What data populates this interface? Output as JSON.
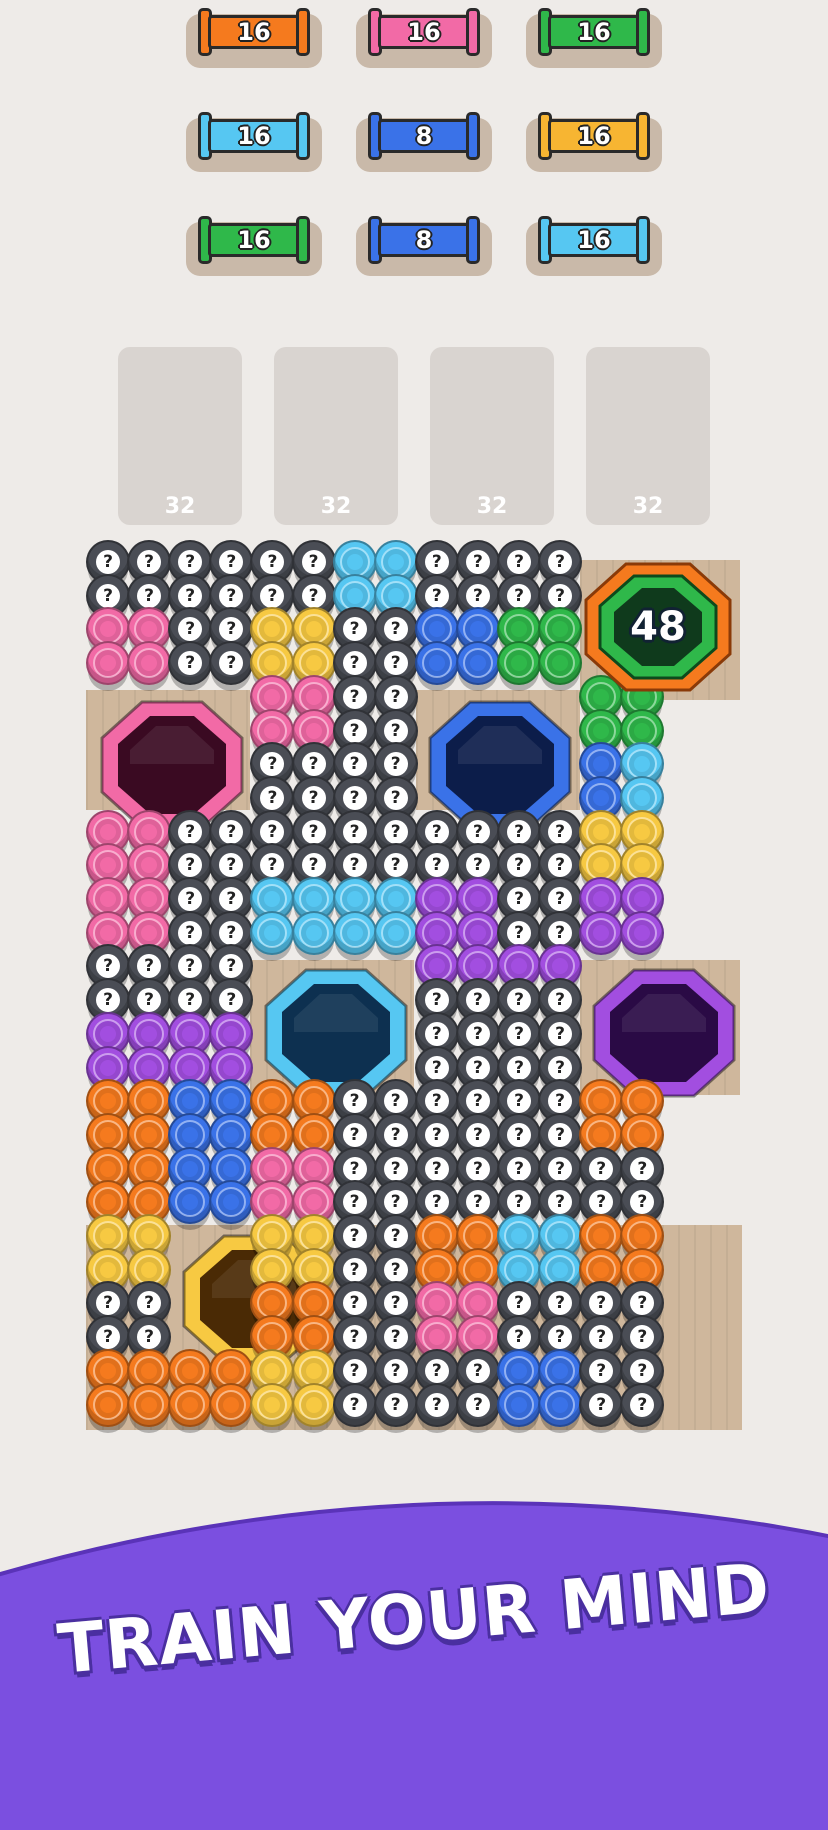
{
  "spools": [
    {
      "value": "16",
      "color": "#f57a1e"
    },
    {
      "value": "16",
      "color": "#f26aa6"
    },
    {
      "value": "16",
      "color": "#2fb84a"
    },
    {
      "value": "16",
      "color": "#56c7f2"
    },
    {
      "value": "8",
      "color": "#3a72e8"
    },
    {
      "value": "16",
      "color": "#f7b532"
    },
    {
      "value": "16",
      "color": "#2fb84a"
    },
    {
      "value": "8",
      "color": "#3a72e8"
    },
    {
      "value": "16",
      "color": "#56c7f2"
    }
  ],
  "slots": [
    {
      "capacity": "32"
    },
    {
      "capacity": "32"
    },
    {
      "capacity": "32"
    },
    {
      "capacity": "32"
    }
  ],
  "goal": {
    "value": "48",
    "color": "#2fb84a"
  },
  "question_mark": "?",
  "colors": {
    "orange": "#f57a1e",
    "pink": "#f26aa6",
    "green": "#2fb84a",
    "lightblue": "#56c7f2",
    "blue": "#3a72e8",
    "yellow": "#f7c942",
    "purple": "#a24ee0",
    "hidden": "#4a4d55"
  },
  "grid_rows": [
    "qqqqqqLLqqqq..",
    "qqqqqqLLqqqq..",
    "PPqqYYqqBBGG..",
    "PPqqYYqqBBGG..",
    "....PPqq....GG",
    "....PPqq....GG",
    "....qqqq....BL",
    "....qqqq....BL",
    "PPqqqqqqqqqqYY",
    "PPqqqqqqqqqqYY",
    "PPqqLLLLVVqqVV",
    "PPqqLLLLVVqqVV",
    "qqqq....VVVV..",
    "qqqq....qqqq..",
    "VVVV....qqqq..",
    "VVVV....qqqq..",
    "OOBBOOqqqqqqOO",
    "OOBBOOqqqqqqOO",
    "OOBBPPqqqqqqqq",
    "OOBBPPqqqqqqqq",
    "YY..YYqqOOLLOO",
    "YY..YYqqOOLLOO",
    "qq..OOqqPPqqqq",
    "qq..OOqqPPqqqq",
    "OOOOYYqqqqBBqq",
    "OOOOYYqqqqBBqq"
  ],
  "holes": [
    {
      "color": "pink",
      "ring": "#f26aa6",
      "inner": "#3a0a22"
    },
    {
      "color": "blue",
      "ring": "#3a72e8",
      "inner": "#0c1d4a"
    },
    {
      "color": "lightblue",
      "ring": "#56c7f2",
      "inner": "#0d3050"
    },
    {
      "color": "purple",
      "ring": "#a24ee0",
      "inner": "#2a0a45"
    },
    {
      "color": "yellow",
      "ring": "#f7c942",
      "inner": "#4a2a05"
    }
  ],
  "banner": {
    "text": "TRAIN YOUR MIND",
    "color": "#7b4fe0"
  }
}
